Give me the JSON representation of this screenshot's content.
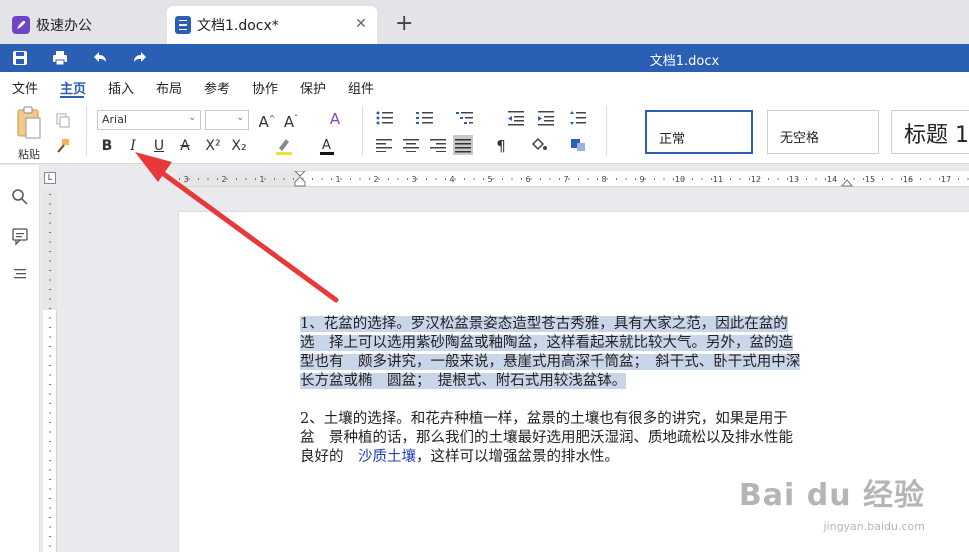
{
  "tabs": {
    "home_label": "极速办公",
    "doc_label": "文档1.docx*",
    "close_symbol": "✕",
    "new_tab_symbol": "+"
  },
  "titlebar": {
    "doc_title": "文档1.docx"
  },
  "menu": {
    "items": [
      "文件",
      "主页",
      "插入",
      "布局",
      "参考",
      "协作",
      "保护",
      "组件"
    ],
    "active_index": 1
  },
  "ribbon": {
    "paste_label": "粘贴",
    "font_name": "Arial",
    "styles": [
      "正常",
      "无空格",
      "标题 1"
    ],
    "format_buttons": {
      "bold": "B",
      "italic": "I",
      "underline": "U",
      "strike": "A",
      "superscript": "X²",
      "subscript": "X₂"
    }
  },
  "ruler": {
    "corner": "L",
    "marks": [
      "3",
      "2",
      "1",
      "1",
      "2",
      "3",
      "4",
      "5",
      "6",
      "7",
      "8",
      "9",
      "10",
      "11",
      "12",
      "13",
      "14",
      "15",
      "16",
      "17"
    ]
  },
  "document": {
    "para1_lines": [
      "1、花盆的选择。罗汉松盆景姿态造型苍古秀雅，具有大家之范，因此在盆的",
      "选　择上可以选用紫砂陶盆或釉陶盆，这样看起来就比较大气。另外，盆的造",
      "型也有　颇多讲究，一般来说，悬崖式用高深千筒盆；　斜干式、卧干式用中深",
      "长方盆或椭　圆盆；　提根式、附石式用较浅盆钵。"
    ],
    "para2_lines": [
      "2、土壤的选择。和花卉种植一样，盆景的土壤也有很多的讲究，如果是用于",
      "盆　景种植的话，那么我们的土壤最好选用肥沃湿润、质地疏松以及排水性能"
    ],
    "para2_last_prefix": "良好的　",
    "para2_link": "沙质土壤",
    "para2_last_suffix": "，这样可以增强盆景的排水性。"
  },
  "watermark": {
    "logo": "Bai du 经验",
    "url": "jingyan.baidu.com"
  },
  "colors": {
    "brand_blue": "#2b5fb4",
    "highlight": "#c9d6ea",
    "arrow_red": "#e8383a"
  }
}
